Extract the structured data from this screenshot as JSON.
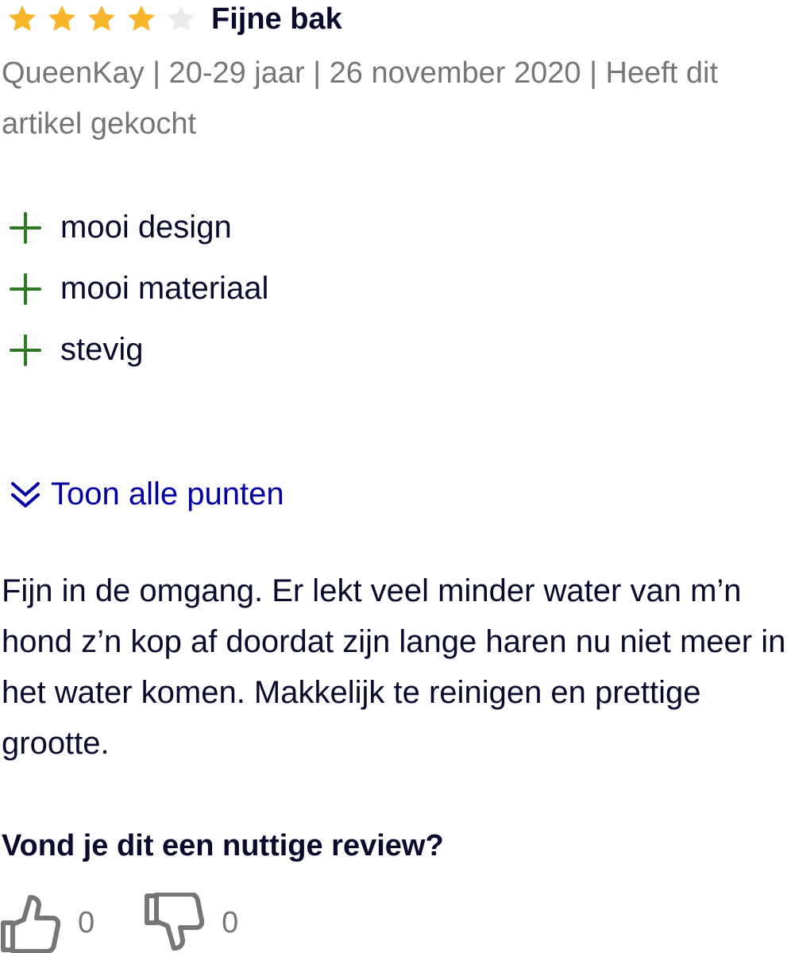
{
  "review": {
    "rating": 4,
    "max_rating": 5,
    "title": "Fijne bak",
    "meta": "QueenKay | 20-29 jaar | 26 november 2020 | Heeft dit artikel gekocht",
    "pros": [
      {
        "label": "mooi design"
      },
      {
        "label": "mooi materiaal"
      },
      {
        "label": "stevig"
      }
    ],
    "show_all_label": "Toon alle punten",
    "body": "Fijn in de omgang. Er lekt veel minder water van m’n hond z’n kop af doordat zijn lange haren nu niet meer in het water komen. Makkelijk te reinigen en prettige grootte."
  },
  "feedback": {
    "question": "Vond je dit een nuttige review?",
    "thumbs_up_count": "0",
    "thumbs_down_count": "0"
  },
  "colors": {
    "star_filled": "#f8b52a",
    "star_empty": "#ebebeb",
    "plus_green": "#2d7a25",
    "link_blue": "#0000a4",
    "text_dark": "#0a0a2c",
    "text_muted": "#767676"
  },
  "icons": {
    "star": "star-icon",
    "plus": "plus-icon",
    "chevron": "double-chevron-down-icon",
    "thumbs_up": "thumbs-up-icon",
    "thumbs_down": "thumbs-down-icon"
  }
}
